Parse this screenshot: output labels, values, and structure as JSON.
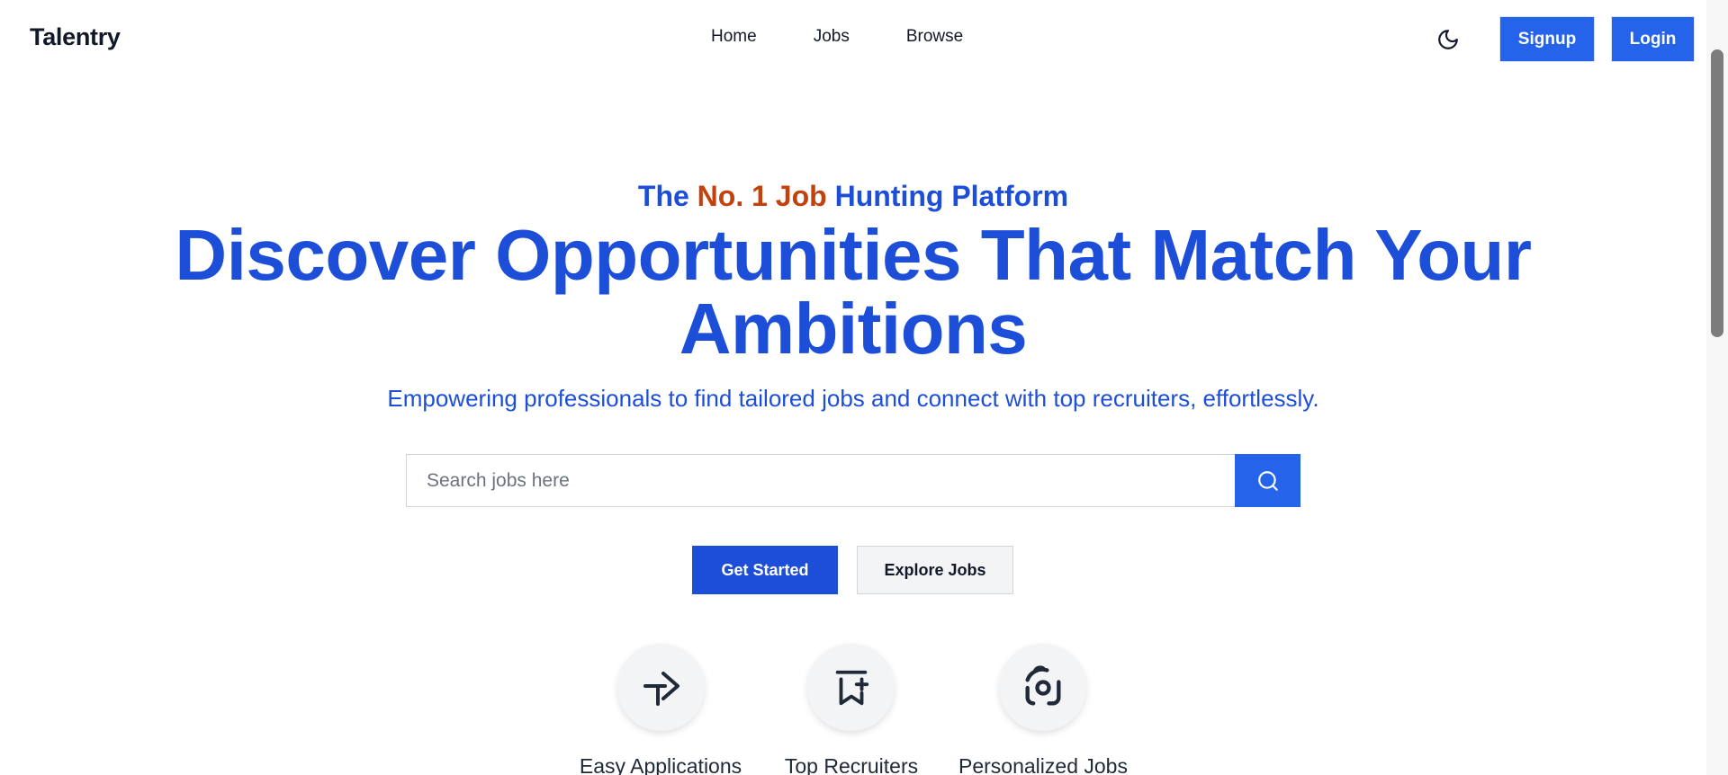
{
  "header": {
    "logo": "Talentry",
    "nav": [
      "Home",
      "Jobs",
      "Browse"
    ],
    "theme_icon": "moon-icon",
    "signup_label": "Signup",
    "login_label": "Login"
  },
  "hero": {
    "tagline_part1": "The ",
    "tagline_accent": "No. 1 Job",
    "tagline_part2": " Hunting Platform",
    "headline_line1": "Discover Opportunities That Match Your",
    "headline_line2": "Ambitions",
    "subtitle": "Empowering professionals to find tailored jobs and connect with top recruiters, effortlessly."
  },
  "search": {
    "placeholder": "Search jobs here",
    "value": "",
    "icon": "search-icon"
  },
  "cta": {
    "get_started": "Get Started",
    "explore_jobs": "Explore Jobs"
  },
  "features": [
    {
      "label": "Easy Applications",
      "icon": "send-arrow-icon"
    },
    {
      "label": "Top Recruiters",
      "icon": "bookmark-plus-icon"
    },
    {
      "label": "Personalized Jobs",
      "icon": "target-icon"
    }
  ],
  "colors": {
    "primary": "#2563eb",
    "headline": "#1d4ed8",
    "accent": "#c2410c"
  }
}
